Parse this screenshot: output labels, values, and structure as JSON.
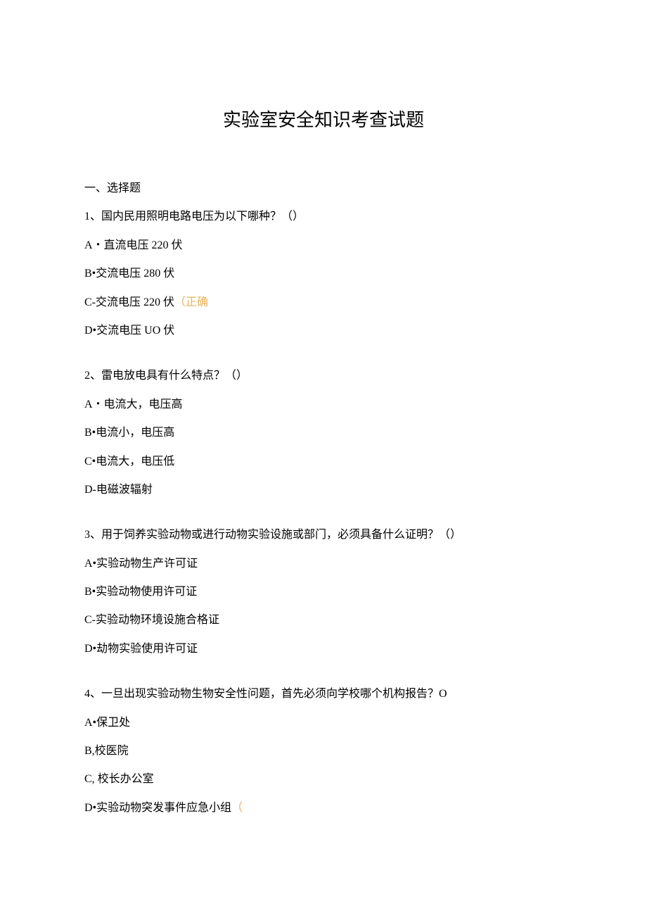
{
  "title": "实验室安全知识考查试题",
  "section_heading": "一、选择题",
  "correct_marker": "（正确",
  "trailing_paren": "（",
  "questions": [
    {
      "stem": "1、国内民用照明电路电压为以下哪种？（）",
      "options": [
        {
          "text": "A・直流电压 220 伏",
          "correct": false
        },
        {
          "text": "B•交流电压 280 伏",
          "correct": false
        },
        {
          "text": "C-交流电压 220 伏",
          "correct": true
        },
        {
          "text": "D•交流电压 UO 伏",
          "correct": false
        }
      ]
    },
    {
      "stem": "2、雷电放电具有什么特点？（）",
      "options": [
        {
          "text": "A・电流大，电压高",
          "correct": false
        },
        {
          "text": "B•电流小，电压高",
          "correct": false
        },
        {
          "text": "C•电流大，电压低",
          "correct": false
        },
        {
          "text": "D-电磁波辐射",
          "correct": false
        }
      ]
    },
    {
      "stem": "3、用于饲养实验动物或进行动物实验设施或部门，必须具备什么证明？（）",
      "options": [
        {
          "text": "A•实验动物生产许可证",
          "correct": false
        },
        {
          "text": "B•实验动物使用许可证",
          "correct": false
        },
        {
          "text": "C-实验动物环境设施合格证",
          "correct": false
        },
        {
          "text": "D•劫物实验使用许可证",
          "correct": false
        }
      ]
    },
    {
      "stem": "4、一旦出现实验动物生物安全性问题，首先必须向学校哪个机构报告？O",
      "options": [
        {
          "text": "A•保卫处",
          "correct": false
        },
        {
          "text": "B,校医院",
          "correct": false
        },
        {
          "text": "C, 校长办公室",
          "correct": false
        },
        {
          "text": "D•实验动物突发事件应急小组",
          "correct": false,
          "trailing": true
        }
      ]
    }
  ]
}
